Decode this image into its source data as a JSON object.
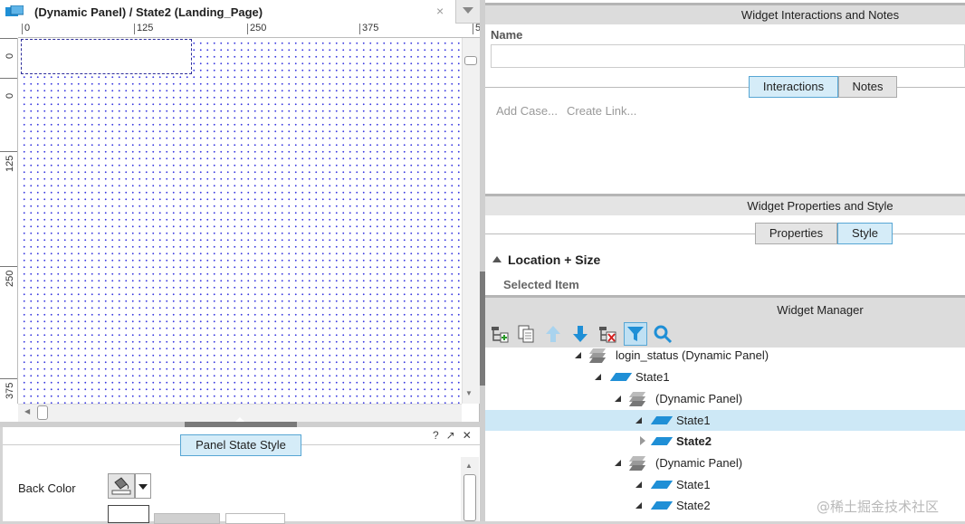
{
  "editor": {
    "tab_title": "(Dynamic Panel) / State2 (Landing_Page)",
    "tab_close": "×",
    "h_ruler": [
      "0",
      "125",
      "250",
      "375",
      "5"
    ],
    "v_ruler": [
      "0",
      "0",
      "125",
      "250",
      "375"
    ]
  },
  "panel_state_style": {
    "tab_label": "Panel State Style",
    "controls": "?↗✕",
    "back_color_label": "Back Color"
  },
  "interactions": {
    "header": "Widget Interactions and Notes",
    "name_label": "Name",
    "name_value": "",
    "tabs": [
      "Interactions",
      "Notes"
    ],
    "active_tab": "Interactions",
    "add_case": "Add Case...",
    "create_link": "Create Link..."
  },
  "properties": {
    "header": "Widget Properties and Style",
    "tabs": [
      "Properties",
      "Style"
    ],
    "active_tab": "Style",
    "section": "Location + Size",
    "selected_item": "Selected Item"
  },
  "widget_manager": {
    "header": "Widget Manager",
    "toolbar_icons": [
      "add-state-icon",
      "duplicate-icon",
      "move-up-icon",
      "move-down-icon",
      "delete-icon",
      "filter-icon",
      "search-icon"
    ],
    "tree": [
      {
        "label": "login_status (Dynamic Panel)",
        "type": "panel",
        "expanded": true,
        "selected": false
      },
      {
        "label": "State1",
        "type": "state",
        "expanded": true,
        "selected": false
      },
      {
        "label": "(Dynamic Panel)",
        "type": "panel",
        "expanded": true,
        "selected": false
      },
      {
        "label": "State1",
        "type": "state",
        "expanded": true,
        "selected": true
      },
      {
        "label": "State2",
        "type": "state",
        "expanded": false,
        "selected": false,
        "bold": true
      },
      {
        "label": "(Dynamic Panel)",
        "type": "panel",
        "expanded": true,
        "selected": false
      },
      {
        "label": "State1",
        "type": "state",
        "expanded": true,
        "selected": false
      },
      {
        "label": "State2",
        "type": "state",
        "expanded": true,
        "selected": false
      }
    ]
  },
  "watermark": "@稀土掘金技术社区",
  "colors": {
    "accent_blue": "#1f8fd6",
    "selected_row": "#cde8f6",
    "active_tab_bg": "#d5ecf8",
    "grid_dot": "#3a3ae0"
  }
}
